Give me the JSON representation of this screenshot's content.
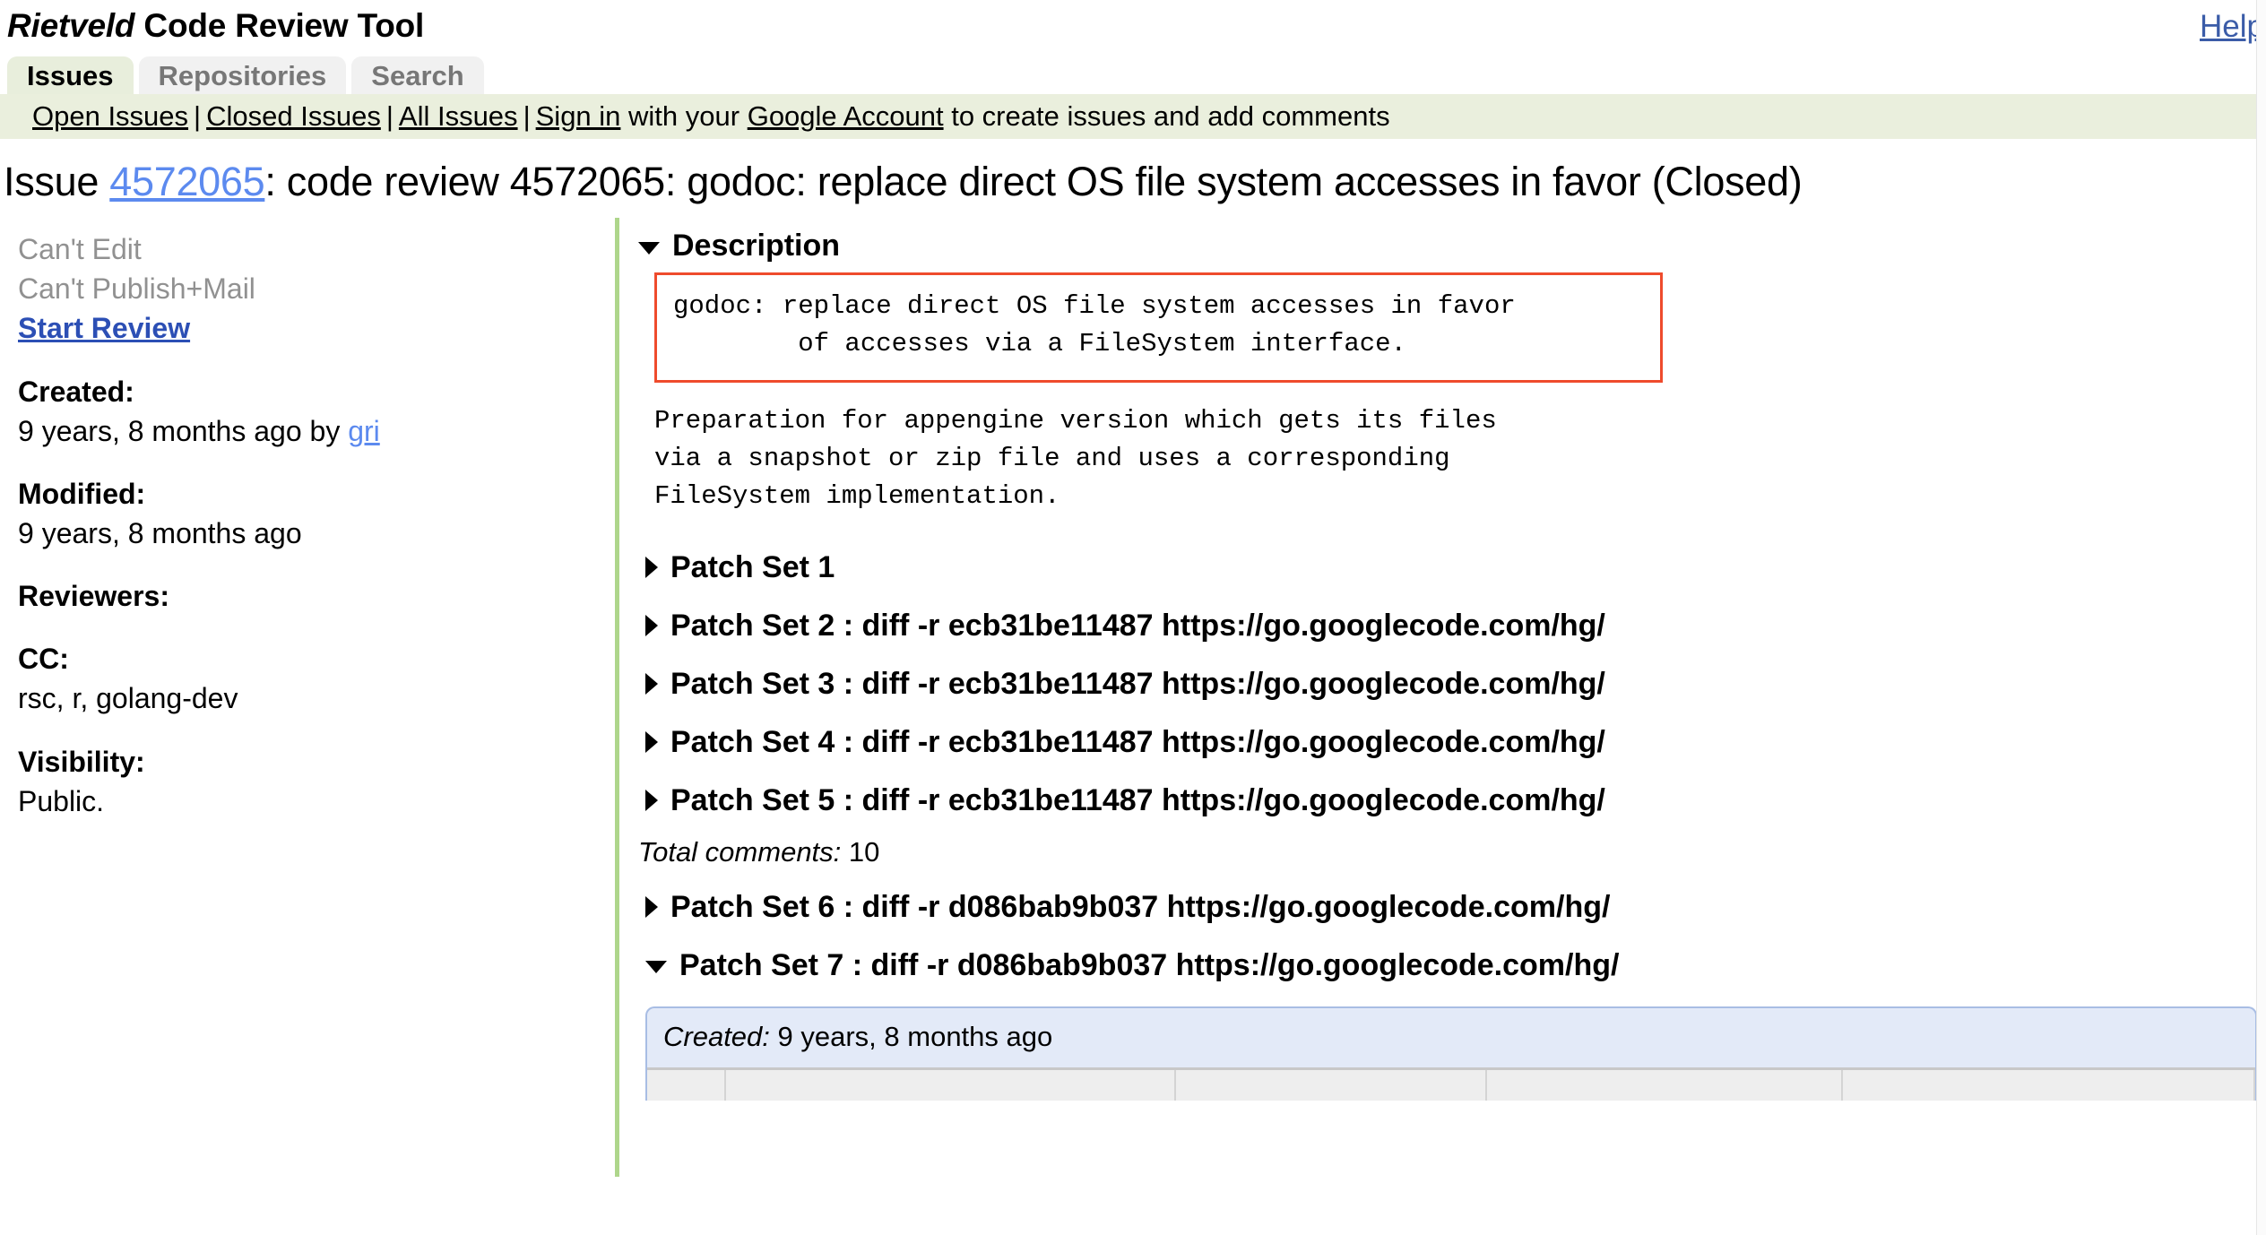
{
  "header": {
    "brand": "Rietveld",
    "title_rest": " Code Review Tool",
    "help_label": "Help"
  },
  "tabs": [
    {
      "label": "Issues",
      "active": true
    },
    {
      "label": "Repositories",
      "active": false
    },
    {
      "label": "Search",
      "active": false
    }
  ],
  "nav": {
    "open_issues": "Open Issues",
    "closed_issues": "Closed Issues",
    "all_issues": "All Issues",
    "sign_in": "Sign in",
    "with_your": " with your ",
    "google_account": "Google Account",
    "tail": " to create issues and add comments",
    "separator": "|"
  },
  "issue": {
    "prefix": "Issue ",
    "number": "4572065",
    "title_rest": ": code review 4572065: godoc: replace direct OS file system accesses in favor (Closed)"
  },
  "sidebar": {
    "cant_edit": "Can't Edit",
    "cant_publish": "Can't Publish+Mail",
    "start_review": "Start Review",
    "created_label": "Created:",
    "created_value": "9 years, 8 months ago by ",
    "created_author": "gri",
    "modified_label": "Modified:",
    "modified_value": "9 years, 8 months ago",
    "reviewers_label": "Reviewers:",
    "reviewers_value": "",
    "cc_label": "CC:",
    "cc_value": "rsc, r, golang-dev",
    "visibility_label": "Visibility:",
    "visibility_value": "Public."
  },
  "description": {
    "heading": "Description",
    "boxed_text": "godoc: replace direct OS file system accesses in favor\n        of accesses via a FileSystem interface.",
    "body_text": "Preparation for appengine version which gets its files\nvia a snapshot or zip file and uses a corresponding\nFileSystem implementation."
  },
  "patch_sets": [
    {
      "label": "Patch Set 1",
      "expanded": false
    },
    {
      "label": "Patch Set 2 : diff -r ecb31be11487 https://go.googlecode.com/hg/",
      "expanded": false
    },
    {
      "label": "Patch Set 3 : diff -r ecb31be11487 https://go.googlecode.com/hg/",
      "expanded": false
    },
    {
      "label": "Patch Set 4 : diff -r ecb31be11487 https://go.googlecode.com/hg/",
      "expanded": false
    },
    {
      "label": "Patch Set 5 : diff -r ecb31be11487 https://go.googlecode.com/hg/",
      "expanded": false
    },
    {
      "label": "Patch Set 6 : diff -r d086bab9b037 https://go.googlecode.com/hg/",
      "expanded": false
    },
    {
      "label": "Patch Set 7 : diff -r d086bab9b037 https://go.googlecode.com/hg/",
      "expanded": true
    }
  ],
  "total_comments": {
    "label": "Total comments:",
    "count": "10"
  },
  "patchset_panel": {
    "created_label": "Created:",
    "created_value": " 9 years, 8 months ago"
  },
  "colors": {
    "nav_background": "#eaefdd",
    "active_tab": "#e8eedc",
    "green_divider": "#aed68b",
    "description_border": "#ef4b2c",
    "link_blue": "#5c8aef",
    "panel_blue": "#e3eaf8"
  }
}
